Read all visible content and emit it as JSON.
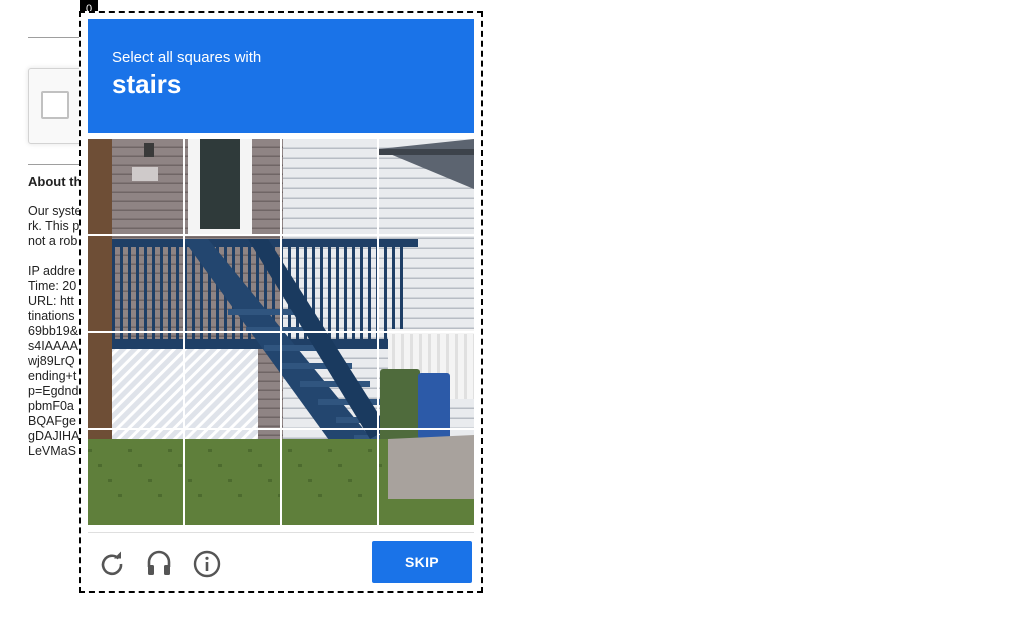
{
  "background_page": {
    "about_heading": "About th",
    "lines": [
      "Our syste",
      "rk. This p",
      "not a rob",
      "",
      "IP addre",
      "Time: 20",
      "URL: htt",
      "tinations",
      "69bb19&",
      "s4IAAAA",
      "wj89LrQ",
      "ending+t",
      "p=Egdnd",
      "pbmF0a",
      "BQAFge",
      "gDAJIHA",
      "LeVMaS"
    ]
  },
  "challenge": {
    "index_badge": "0",
    "instruction": "Select all squares with",
    "target": "stairs",
    "grid_rows": 4,
    "grid_cols": 4,
    "image_content": "house porch",
    "controls": {
      "reload_icon": "reload-icon",
      "audio_icon": "headphones-icon",
      "info_icon": "info-icon"
    },
    "skip_label": "SKIP",
    "accent_color": "#1a73e8"
  }
}
